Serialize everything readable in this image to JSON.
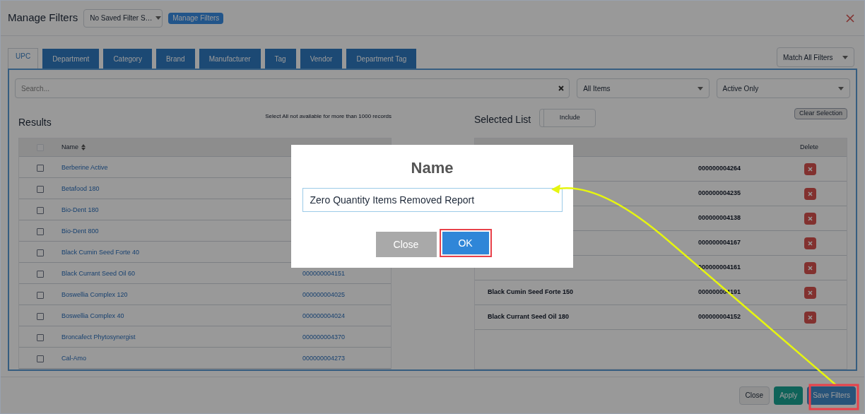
{
  "header": {
    "title": "Manage Filters",
    "saved_filter_select": "No Saved Filter S…",
    "manage_button": "Manage Filters"
  },
  "tabs": [
    {
      "label": "UPC",
      "selected": true
    },
    {
      "label": "Department",
      "selected": false
    },
    {
      "label": "Category",
      "selected": false
    },
    {
      "label": "Brand",
      "selected": false
    },
    {
      "label": "Manufacturer",
      "selected": false
    },
    {
      "label": "Tag",
      "selected": false
    },
    {
      "label": "Vendor",
      "selected": false
    },
    {
      "label": "Department Tag",
      "selected": false
    }
  ],
  "match_select": "Match All Filters",
  "search": {
    "placeholder": "Search..."
  },
  "item_filter": "All Items",
  "status_filter": "Active Only",
  "results": {
    "title": "Results",
    "note": "Select All not available for more than 1000 records",
    "name_column": "Name",
    "select_all_checked": false,
    "rows": [
      {
        "name": "Berberine Active",
        "checked": false
      },
      {
        "name": "Betafood 180",
        "checked": false
      },
      {
        "name": "Bio-Dent 180",
        "checked": false
      },
      {
        "name": "Bio-Dent 800",
        "checked": false
      },
      {
        "name": "Black Cumin Seed Forte 40",
        "checked": false
      },
      {
        "name": "Black Currant Seed Oil 60",
        "upc": "000000004151",
        "checked": false
      },
      {
        "name": "Boswellia Complex 120",
        "upc": "000000004025",
        "checked": false
      },
      {
        "name": "Boswellia Complex 40",
        "upc": "000000004024",
        "checked": false
      },
      {
        "name": "Broncafect Phytosynergist",
        "upc": "000000004370",
        "checked": false
      },
      {
        "name": "Cal-Amo",
        "upc": "000000004273",
        "checked": false
      }
    ]
  },
  "selected_list": {
    "title": "Selected List",
    "toggle": "Include",
    "clear_button": "Clear Selection",
    "delete_column": "Delete",
    "rows": [
      {
        "upc": "000000004264"
      },
      {
        "upc": "000000004235"
      },
      {
        "upc": "000000004138"
      },
      {
        "upc": "000000004167"
      },
      {
        "upc": "000000004161"
      },
      {
        "name": "Black Cumin Seed Forte 150",
        "upc": "000000004191"
      },
      {
        "name": "Black Currant Seed Oil 180",
        "upc": "000000004152"
      }
    ]
  },
  "footer_buttons": [
    {
      "label": "Close",
      "kind": "default"
    },
    {
      "label": "Apply",
      "kind": "success"
    },
    {
      "label": "Save Filters",
      "kind": "primary"
    }
  ],
  "dialog": {
    "title": "Name",
    "value": "Zero Quantity Items Removed Report",
    "buttons": [
      {
        "label": "Close",
        "kind": "secondary"
      },
      {
        "label": "OK",
        "kind": "primary"
      }
    ]
  }
}
